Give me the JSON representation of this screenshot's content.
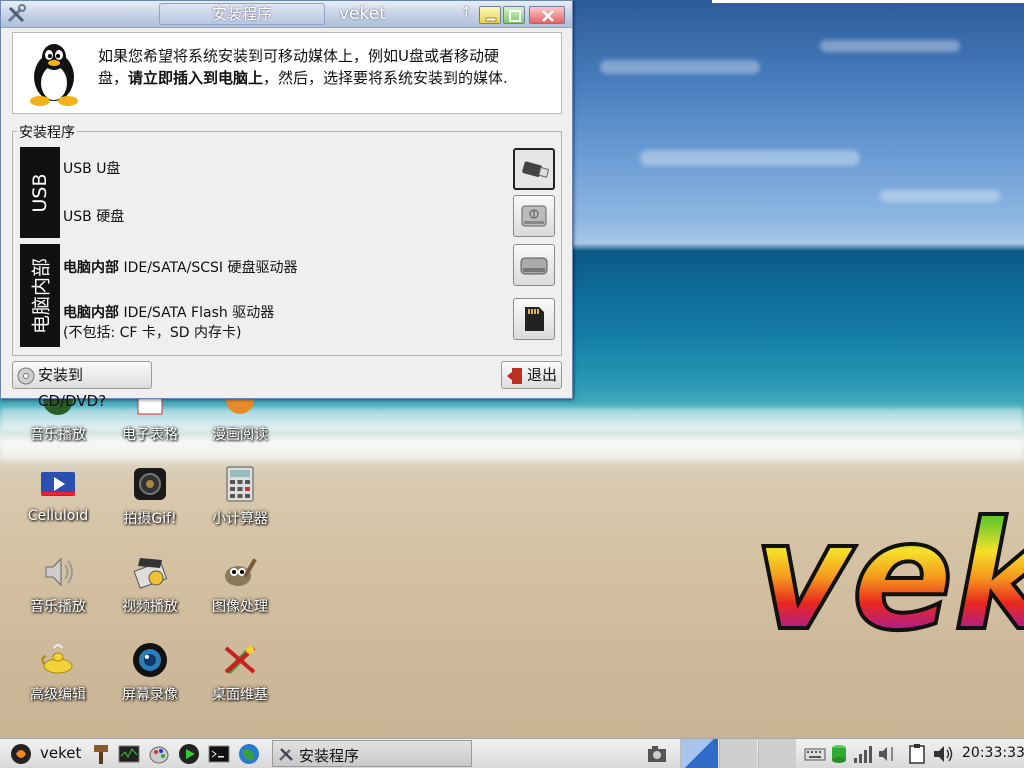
{
  "window": {
    "title": "安装程序",
    "app_name": "veket",
    "header_line1": "如果您希望将系统安装到可移动媒体上，例如U盘或者移动硬",
    "header_line2_a": "盘，",
    "header_line2_bold": "请立即插入到电脑上",
    "header_line2_b": "，然后，选择要将系统安装到的媒体.",
    "group_label": "安装程序",
    "usb_label": "USB",
    "internal_label": "电脑内部",
    "options": [
      {
        "text": "USB U盘",
        "icon": "usb-flash-icon",
        "selected": true
      },
      {
        "text": "USB 硬盘",
        "icon": "usb-harddisk-icon"
      },
      {
        "bold": "电脑内部",
        "text": " IDE/SATA/SCSI 硬盘驱动器",
        "icon": "harddisk-icon"
      },
      {
        "bold": "电脑内部",
        "text": " IDE/SATA Flash 驱动器",
        "note": "(不包括: CF 卡，SD 内存卡)",
        "icon": "sd-card-icon"
      }
    ],
    "cd_button": "安装到CD/DVD?",
    "exit_button": "退出"
  },
  "desktop_icons": [
    {
      "label": "音乐播放",
      "icon": "music-player-icon"
    },
    {
      "label": "电子表格",
      "icon": "spreadsheet-icon"
    },
    {
      "label": "漫画阅读",
      "icon": "comic-reader-icon"
    },
    {
      "label": "Celluloid",
      "icon": "celluloid-icon"
    },
    {
      "label": "拍摄Gif!",
      "icon": "camera-gif-icon"
    },
    {
      "label": "小计算器",
      "icon": "calculator-icon"
    },
    {
      "label": "音乐播放",
      "icon": "speaker-icon"
    },
    {
      "label": "视频播放",
      "icon": "video-player-icon"
    },
    {
      "label": "图像处理",
      "icon": "gimp-icon"
    },
    {
      "label": "高级编辑",
      "icon": "genie-lamp-icon"
    },
    {
      "label": "屏幕录像",
      "icon": "screen-recorder-icon"
    },
    {
      "label": "桌面维基",
      "icon": "desktop-wiki-icon"
    }
  ],
  "taskbar": {
    "start_label": "veket",
    "task_label": "安装程序",
    "clock": "20:33:33"
  },
  "colors": {
    "title_gradient": "#c7d3e6",
    "accent_blue": "#4a7fc8"
  }
}
